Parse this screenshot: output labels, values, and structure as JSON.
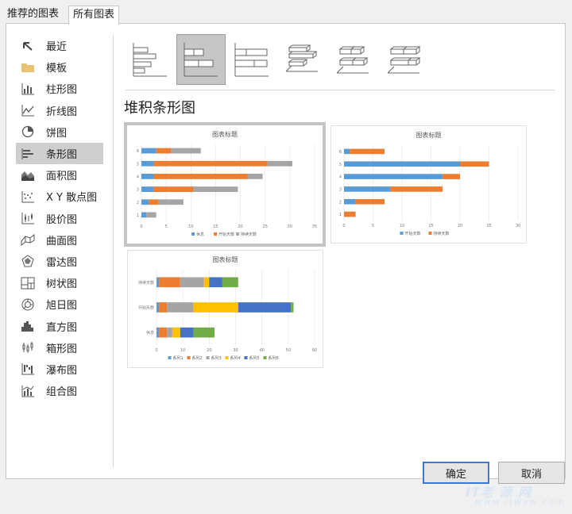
{
  "tabs": [
    {
      "label": "推荐的图表",
      "active": false
    },
    {
      "label": "所有图表",
      "active": true
    }
  ],
  "sidebar": {
    "items": [
      {
        "label": "最近",
        "icon": "recent-icon"
      },
      {
        "label": "模板",
        "icon": "folder-icon"
      },
      {
        "label": "柱形图",
        "icon": "column-chart-icon"
      },
      {
        "label": "折线图",
        "icon": "line-chart-icon"
      },
      {
        "label": "饼图",
        "icon": "pie-chart-icon"
      },
      {
        "label": "条形图",
        "icon": "bar-chart-icon",
        "selected": true
      },
      {
        "label": "面积图",
        "icon": "area-chart-icon"
      },
      {
        "label": "X Y 散点图",
        "icon": "scatter-chart-icon"
      },
      {
        "label": "股价图",
        "icon": "stock-chart-icon"
      },
      {
        "label": "曲面图",
        "icon": "surface-chart-icon"
      },
      {
        "label": "雷达图",
        "icon": "radar-chart-icon"
      },
      {
        "label": "树状图",
        "icon": "treemap-chart-icon"
      },
      {
        "label": "旭日图",
        "icon": "sunburst-chart-icon"
      },
      {
        "label": "直方图",
        "icon": "histogram-chart-icon"
      },
      {
        "label": "箱形图",
        "icon": "box-whisker-chart-icon"
      },
      {
        "label": "瀑布图",
        "icon": "waterfall-chart-icon"
      },
      {
        "label": "组合图",
        "icon": "combo-chart-icon"
      }
    ]
  },
  "subtypes": [
    {
      "icon": "clustered-bar-icon",
      "selected": false
    },
    {
      "icon": "stacked-bar-icon",
      "selected": true
    },
    {
      "icon": "100-stacked-bar-icon",
      "selected": false
    },
    {
      "icon": "3d-clustered-bar-icon",
      "selected": false
    },
    {
      "icon": "3d-stacked-bar-icon",
      "selected": false
    },
    {
      "icon": "3d-100-stacked-bar-icon",
      "selected": false
    }
  ],
  "chart_type_title": "堆积条形图",
  "buttons": {
    "ok": "确定",
    "cancel": "取消"
  },
  "watermark": {
    "line1": "IT老 源 网",
    "line2": "www.itwvw.com"
  },
  "colors": {
    "blue": "#5b9bd5",
    "orange": "#ed7d31",
    "gray": "#a5a5a5",
    "yellow": "#ffc000",
    "darkblue": "#4472c4",
    "green": "#70ad47"
  },
  "chart_data": [
    {
      "type": "bar",
      "stacked": true,
      "title": "图表标题",
      "categories": [
        "1",
        "2",
        "3",
        "4",
        "5",
        "6"
      ],
      "series": [
        {
          "name": "休息",
          "values": [
            1,
            1.5,
            2.5,
            2.5,
            2.5,
            3
          ]
        },
        {
          "name": "开始天数",
          "values": [
            0,
            2,
            8,
            19,
            23,
            3
          ]
        },
        {
          "name": "持续天数",
          "values": [
            2,
            5,
            9,
            3,
            5,
            6
          ]
        }
      ],
      "xlim": [
        0,
        35
      ],
      "ticks": [
        "0",
        "5",
        "10",
        "15",
        "20",
        "25",
        "30",
        "35"
      ],
      "legend": "bottom",
      "selected": true
    },
    {
      "type": "bar",
      "stacked": true,
      "title": "图表标题",
      "categories": [
        "1",
        "2",
        "3",
        "4",
        "5",
        "6"
      ],
      "series": [
        {
          "name": "开始天数",
          "values": [
            0,
            2,
            8,
            17,
            20,
            1
          ]
        },
        {
          "name": "持续天数",
          "values": [
            2,
            5,
            9,
            3,
            5,
            6
          ]
        }
      ],
      "xlim": [
        0,
        30
      ],
      "ticks": [
        "0",
        "5",
        "10",
        "15",
        "20",
        "25",
        "30"
      ],
      "legend": "bottom",
      "selected": false
    },
    {
      "type": "bar",
      "stacked": true,
      "title": "图表标题",
      "categories": [
        "休息",
        "开始天数",
        "持续天数"
      ],
      "series": [
        {
          "name": "系列1",
          "values": [
            1,
            1,
            1
          ]
        },
        {
          "name": "系列2",
          "values": [
            3,
            3,
            8
          ]
        },
        {
          "name": "系列3",
          "values": [
            2,
            10,
            9
          ]
        },
        {
          "name": "系列4",
          "values": [
            3,
            17,
            2
          ]
        },
        {
          "name": "系列5",
          "values": [
            5,
            20,
            5
          ]
        },
        {
          "name": "系列6",
          "values": [
            8,
            1,
            6
          ]
        }
      ],
      "xlim": [
        0,
        60
      ],
      "ticks": [
        "0",
        "10",
        "20",
        "30",
        "40",
        "50",
        "60"
      ],
      "legend": "bottom",
      "selected": false
    }
  ]
}
